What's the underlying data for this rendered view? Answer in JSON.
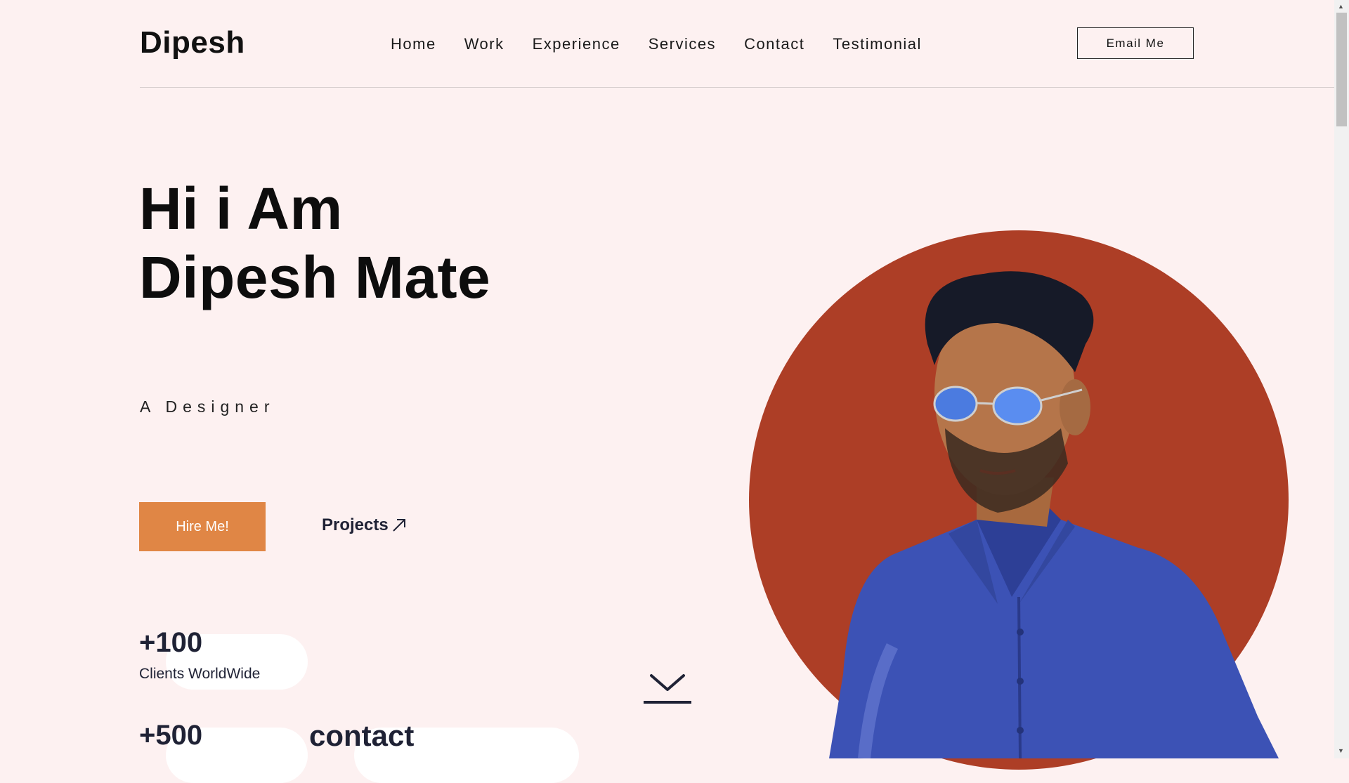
{
  "header": {
    "logo": "Dipesh",
    "nav": [
      "Home",
      "Work",
      "Experience",
      "Services",
      "Contact",
      "Testimonial"
    ],
    "email_button": "Email Me"
  },
  "hero": {
    "title_line1": "Hi i Am",
    "title_line2": "Dipesh Mate",
    "subtitle": "A Designer",
    "hire_button": "Hire Me!",
    "projects_link": "Projects",
    "projects_icon": "arrow-up-right-icon"
  },
  "stats": [
    {
      "value": "+100",
      "label": "Clients WorldWide"
    },
    {
      "value": "+500",
      "label": ""
    }
  ],
  "contact_word": "contact",
  "colors": {
    "background": "#fdf1f1",
    "accent": "#e08645",
    "circle": "#ad3e26",
    "text_dark": "#1f2235"
  }
}
